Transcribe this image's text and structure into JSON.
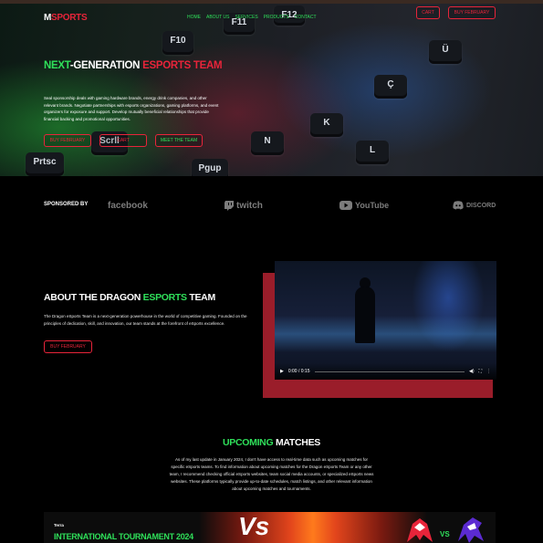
{
  "nav": {
    "logo_mark": "M",
    "logo_text": "SPORTS",
    "links": [
      "HOME",
      "ABOUT US",
      "SERVICES",
      "PRODUCTS",
      "CONTACT"
    ],
    "cart_label": "CART",
    "buy_label": "BUY FEBRUARY"
  },
  "hero": {
    "title_part1": "NEXT",
    "title_part2": "-GENERATION ",
    "title_part3": "ESPORTS TEAM",
    "description": "Seal sponsorship deals with gaming hardware brands, energy drink companies, and other relevant brands. Negotiate partnerships with esports organizations, gaming platforms, and event organizers for exposure and support. Develop mutually beneficial relationships that provide financial backing and promotional opportunities.",
    "buttons": [
      "BUY FEBRUARY",
      "CART",
      "MEET THE TEAM"
    ],
    "keys": [
      "F10",
      "F11",
      "F12",
      "Prtsc",
      "Scrll",
      "Pgup",
      "Ç",
      "K",
      "L",
      "N",
      "Ü"
    ]
  },
  "sponsors": {
    "label": "SPONSORED BY",
    "items": [
      {
        "name": "facebook",
        "icon": "facebook-logo"
      },
      {
        "name": "twitch",
        "icon": "twitch-logo"
      },
      {
        "name": "YouTube",
        "icon": "youtube-logo"
      },
      {
        "name": "DISCORD",
        "icon": "discord-logo"
      }
    ]
  },
  "about": {
    "title_part1": "ABOUT THE DRAGON ",
    "title_part2": "ESPORTS",
    "title_part3": " TEAM",
    "description": "The Dragon eSports Team is a next-generation powerhouse in the world of competitive gaming. Founded on the principles of dedication, skill, and innovation, our team stands at the forefront of eSports excellence.",
    "button": "BUY FEBRUARY",
    "video_time": "0:00 / 0:15"
  },
  "matches": {
    "title_part1": "UPCOMING",
    "title_part2": " MATCHES",
    "description": "As of my last update in January 2024, I don't have access to real-time data such as upcoming matches for specific eSports teams. To find information about upcoming matches for the Dragon eSports Team or any other team, I recommend checking official eSports websites, team social media accounts, or specialized eSports news websites. These platforms typically provide up-to-date schedules, match listings, and other relevant information about upcoming matches and tournaments.",
    "card": {
      "tag": "Terra",
      "name": "INTERNATIONAL TOURNAMENT 2024",
      "vs_graphic": "Vs",
      "vs": "VS"
    }
  },
  "colors": {
    "accent_green": "#2fe05a",
    "accent_red": "#e8243a",
    "frame_red": "#9a1d2a"
  }
}
